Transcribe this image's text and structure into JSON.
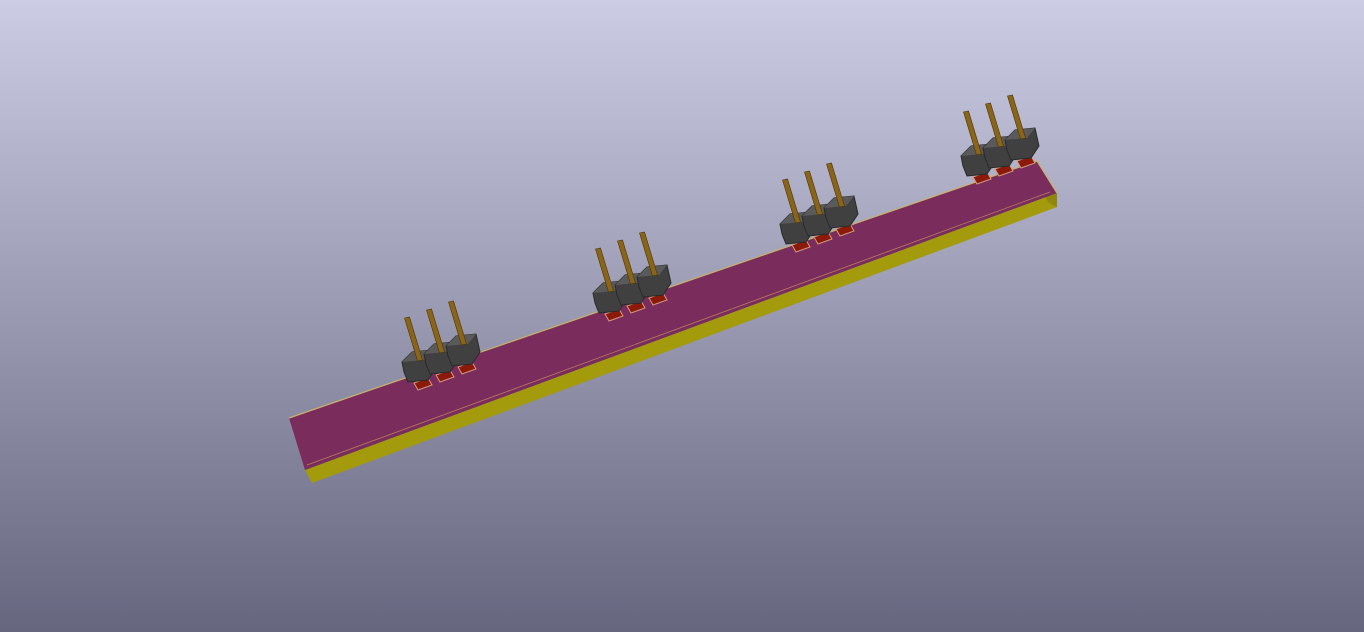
{
  "viewer": {
    "background_top_color": "#cccce4",
    "background_bottom_color": "#66667f"
  },
  "board": {
    "top_color": "#7a2d5d",
    "edge_color": "#a39a0c",
    "outline_color": "#c8b26a",
    "connector_count": 4,
    "pins_per_connector": 3
  },
  "connector": {
    "body_color": "#404040",
    "pin_color": "#8a6418",
    "pad_color": "#8b1a0a",
    "pad_border_color": "#d09a80"
  }
}
